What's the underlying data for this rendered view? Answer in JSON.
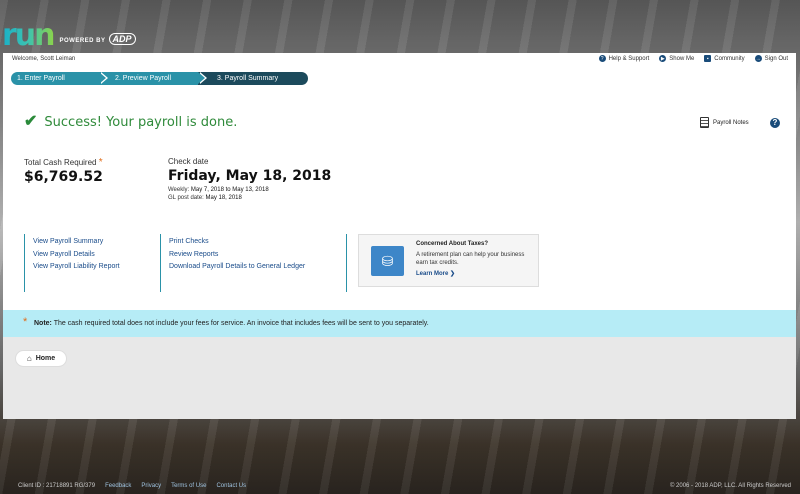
{
  "brand": {
    "logo_text": "run",
    "powered_by": "POWERED BY",
    "adp": "ADP"
  },
  "header": {
    "welcome": "Welcome, Scott Leiman",
    "links": [
      {
        "label": "Help & Support",
        "icon": "help-icon"
      },
      {
        "label": "Show Me",
        "icon": "play-icon"
      },
      {
        "label": "Community",
        "icon": "cart-icon"
      },
      {
        "label": "Sign Out",
        "icon": "signout-icon"
      }
    ]
  },
  "steps": [
    {
      "label": "1.  Enter Payroll"
    },
    {
      "label": "2.  Preview Payroll"
    },
    {
      "label": "3.  Payroll Summary"
    }
  ],
  "success": {
    "message": "Success! Your payroll is done."
  },
  "notes_label": "Payroll Notes",
  "cash": {
    "label": "Total Cash Required",
    "asterisk": "*",
    "value": "$6,769.52"
  },
  "check": {
    "label": "Check date",
    "value": "Friday, May 18, 2018",
    "weekly_label": "Weekly:",
    "period_start": "May 7, 2018",
    "period_to": "to",
    "period_end": "May 13, 2018",
    "gl_label": "GL post date:",
    "gl_value": "May 18, 2018"
  },
  "links_col1": [
    "View Payroll Summary",
    "View Payroll Details",
    "View Payroll Liability Report"
  ],
  "links_col2": [
    "Print Checks",
    "Review Reports",
    "Download Payroll Details to General Ledger"
  ],
  "promo": {
    "title": "Concerned About Taxes?",
    "text": "A retirement plan can help your business earn tax credits.",
    "link": "Learn More"
  },
  "note": {
    "label": "Note:",
    "text": "The cash required total does not include your fees for service. An invoice that includes fees will be sent to you separately."
  },
  "home_button": "Home",
  "footer": {
    "client_id": "Client ID : 21718891 RG/379",
    "links": [
      "Feedback",
      "Privacy",
      "Terms of Use",
      "Contact Us"
    ],
    "copyright": "© 2006 - 2018 ADP, LLC. All Rights Reserved"
  },
  "colors": {
    "accent": "#2a92a8",
    "success": "#2f8a3a",
    "note_bg": "#b6ecf6",
    "link": "#1a4c8a"
  }
}
